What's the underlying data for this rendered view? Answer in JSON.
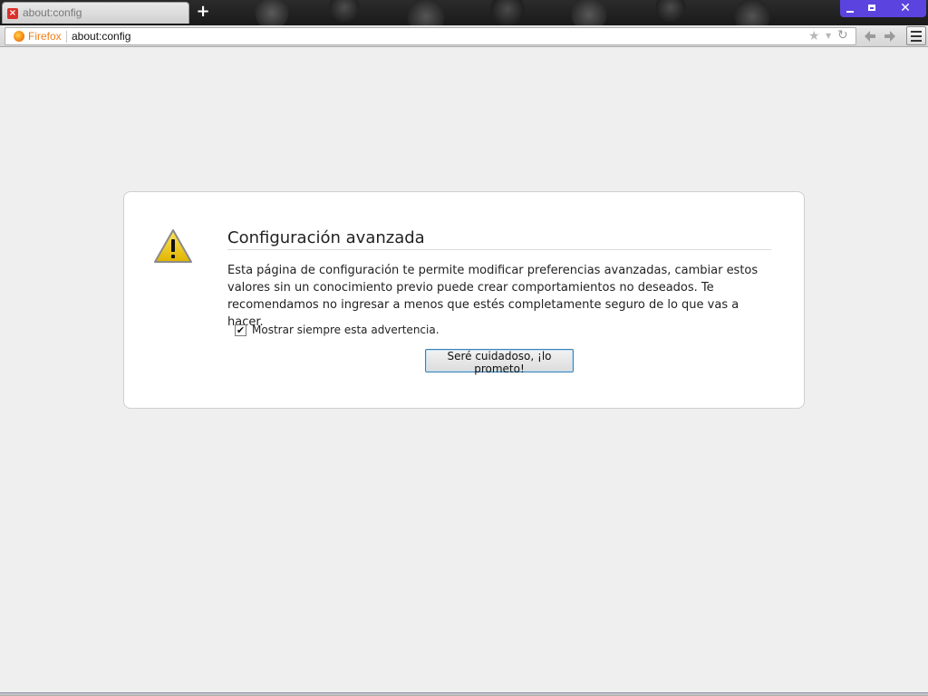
{
  "window": {
    "tab_title": "about:config",
    "new_tab_label": "+",
    "close_label": "✕"
  },
  "navbar": {
    "identity_label": "Firefox",
    "url": "about:config"
  },
  "warning": {
    "title": "Configuración avanzada",
    "description": "Esta página de configuración te permite modificar preferencias avanzadas, cambiar estos valores sin un conocimiento previo puede crear comportamientos no deseados. Te recomendamos no ingresar a menos que estés completamente seguro de lo que vas a hacer.",
    "checkbox_label": "Mostrar siempre esta advertencia.",
    "checkbox_checked": true,
    "button_label": "Seré cuidadoso, ¡lo prometo!"
  },
  "colors": {
    "window_controls": "#5b43e0",
    "identity_text": "#f07d1a",
    "page_background": "#efefef"
  },
  "icons": [
    "close-tab-favicon",
    "new-tab-icon",
    "minimize-icon",
    "maximize-icon",
    "close-icon",
    "firefox-icon",
    "star-icon",
    "reload-icon",
    "back-icon",
    "forward-icon",
    "menu-icon",
    "warning-icon"
  ]
}
